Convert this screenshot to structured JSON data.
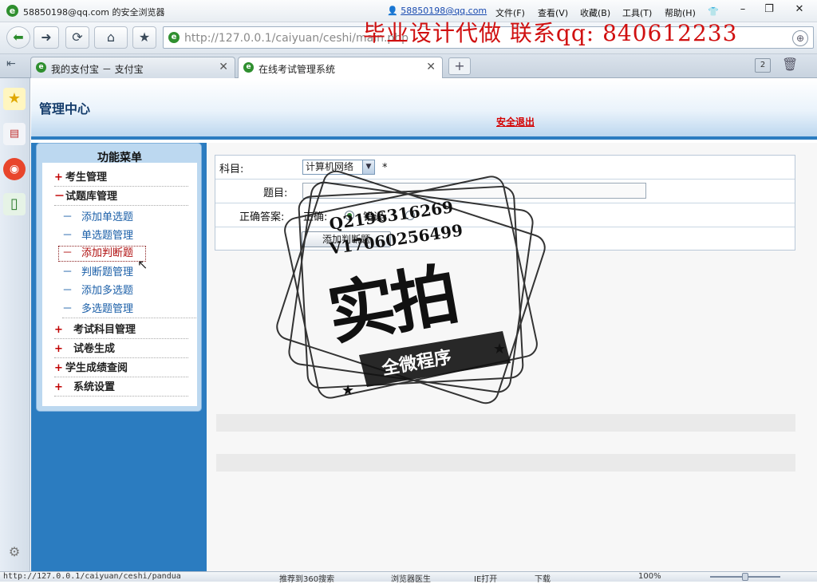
{
  "window": {
    "title": "58850198@qq.com 的安全浏览器",
    "user": "58850198@qq.com",
    "menus": [
      "文件(F)",
      "查看(V)",
      "收藏(B)",
      "工具(T)",
      "帮助(H)"
    ],
    "promo": "毕业设计代做 联系qq: 840612233"
  },
  "nav": {
    "url": "http://127.0.0.1/caiyuan/ceshi/main.php"
  },
  "tabs": [
    {
      "label": "我的支付宝 － 支付宝"
    },
    {
      "label": "在线考试管理系统"
    }
  ],
  "tab_count": "2",
  "header": {
    "title": "管理中心",
    "logout": "安全退出"
  },
  "sidebar": {
    "title": "功能菜单",
    "items": [
      {
        "sym": "+",
        "label": "考生管理"
      },
      {
        "sym": "－",
        "label": "试题库管理"
      },
      {
        "sym": "－",
        "label": "添加单选题"
      },
      {
        "sym": "－",
        "label": "单选题管理"
      },
      {
        "sym": "－",
        "label": "添加判断题"
      },
      {
        "sym": "－",
        "label": "判断题管理"
      },
      {
        "sym": "－",
        "label": "添加多选题"
      },
      {
        "sym": "－",
        "label": "多选题管理"
      },
      {
        "sym": "+",
        "label": "考试科目管理"
      },
      {
        "sym": "+",
        "label": "试卷生成"
      },
      {
        "sym": "+",
        "label": "学生成绩查阅"
      },
      {
        "sym": "+",
        "label": "系统设置"
      }
    ]
  },
  "form": {
    "subject_label": "科目:",
    "subject_value": "计算机网络",
    "required_mark": "*",
    "question_label": "题目:",
    "answer_label": "正确答案:",
    "answer_true": "正确:",
    "answer_false": "错误:",
    "submit": "添加判断题"
  },
  "watermark": {
    "line1": "Q2196316269",
    "line2": "V17060256499",
    "main": "实拍",
    "ribbon": "全微程序"
  },
  "status": {
    "url": "http://127.0.0.1/caiyuan/ceshi/pandua",
    "items": [
      "推荐到360搜索",
      "浏览器医生",
      "IE打开",
      "下载"
    ],
    "zoom": "100%"
  },
  "colors": {
    "accent": "#2b7cc0",
    "promo": "#d01010",
    "logout": "#d40000",
    "menu_sym": "#c00000"
  }
}
